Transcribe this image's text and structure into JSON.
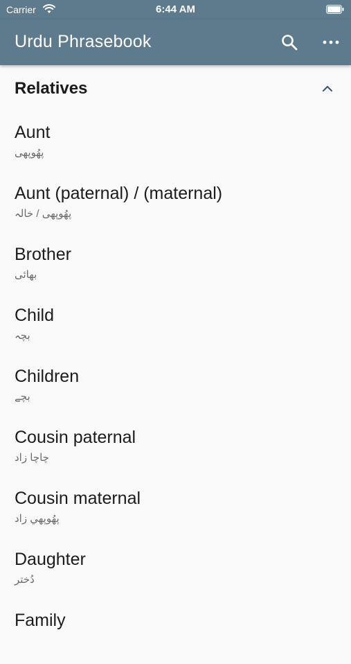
{
  "status_bar": {
    "carrier": "Carrier",
    "time": "6:44 AM"
  },
  "app_bar": {
    "title": "Urdu Phrasebook",
    "search_icon": "search-icon",
    "more_icon": "more-horizontal-icon"
  },
  "section": {
    "title": "Relatives",
    "collapse_icon": "chevron-up-icon"
  },
  "items": [
    {
      "en": "Aunt",
      "ur": "پھُوپھی"
    },
    {
      "en": "Aunt (paternal) / (maternal)",
      "ur": "پھُوپھی / خالہ"
    },
    {
      "en": "Brother",
      "ur": "بھائی"
    },
    {
      "en": "Child",
      "ur": "بچہ"
    },
    {
      "en": "Children",
      "ur": "بچے"
    },
    {
      "en": "Cousin paternal",
      "ur": "چاچا زاد"
    },
    {
      "en": "Cousin maternal",
      "ur": "پھُوپھي زاد"
    },
    {
      "en": "Daughter",
      "ur": "دُختر"
    },
    {
      "en": "Family",
      "ur": ""
    }
  ],
  "colors": {
    "app_bar": "#5d7b8d",
    "background": "#f9f9f9",
    "primary_text": "#1c1c1c",
    "secondary_text": "#6b6b6b"
  }
}
